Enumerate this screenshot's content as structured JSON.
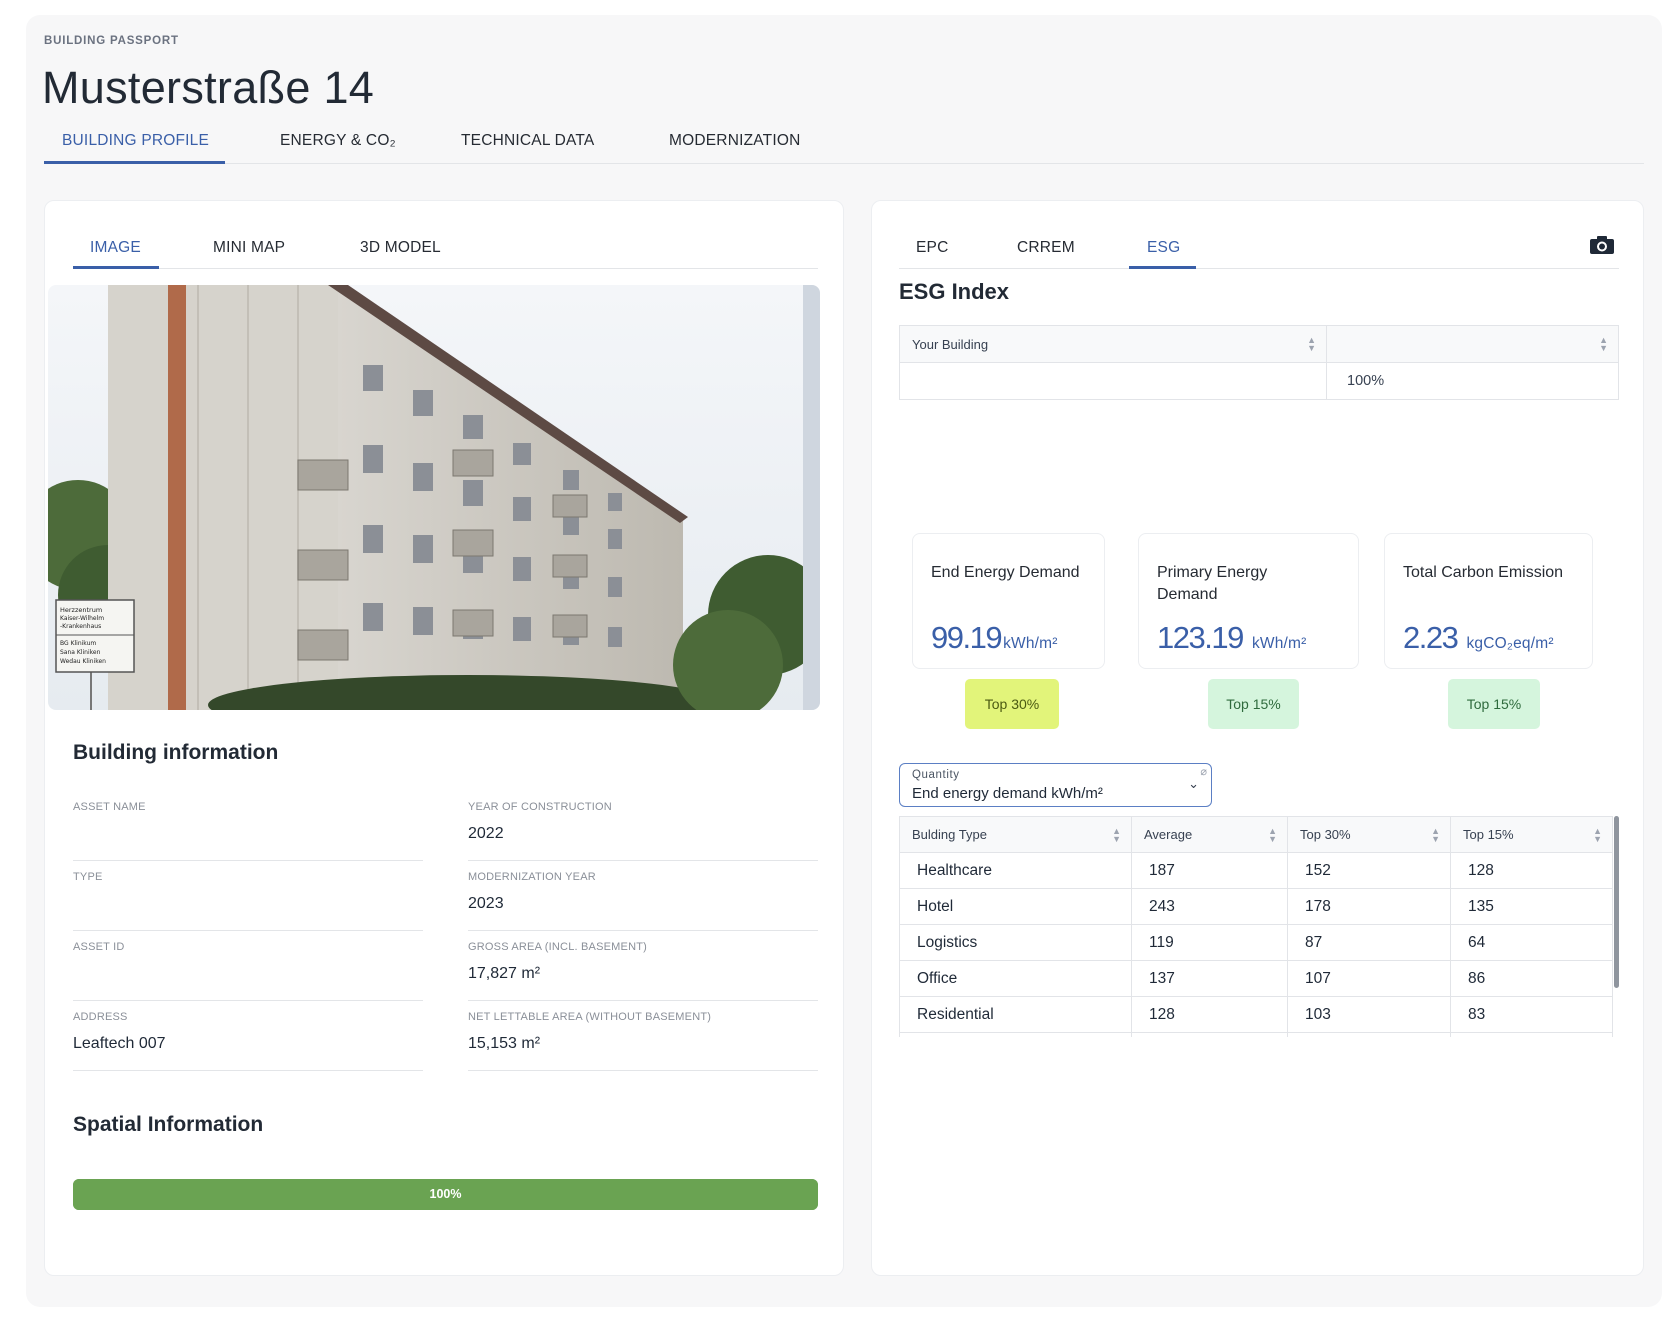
{
  "header": {
    "eyebrow": "BUILDING PASSPORT",
    "title": "Musterstraße 14"
  },
  "main_tabs": [
    {
      "label": "BUILDING PROFILE",
      "active": true
    },
    {
      "label": "ENERGY & CO₂",
      "active": false
    },
    {
      "label": "TECHNICAL DATA",
      "active": false
    },
    {
      "label": "MODERNIZATION",
      "active": false
    }
  ],
  "left": {
    "tabs": [
      {
        "label": "IMAGE",
        "active": true
      },
      {
        "label": "MINI MAP",
        "active": false
      },
      {
        "label": "3D MODEL",
        "active": false
      }
    ],
    "image_sign_lines": [
      "Herzzentrum",
      "Kaiser-Wilhelm",
      "-Krankenhaus",
      "BG Klinikum",
      "Sana Kliniken",
      "Wedau Kliniken"
    ],
    "building_info": {
      "title": "Building information",
      "fields": [
        {
          "label": "ASSET NAME",
          "value": ""
        },
        {
          "label": "YEAR OF CONSTRUCTION",
          "value": "2022"
        },
        {
          "label": "TYPE",
          "value": ""
        },
        {
          "label": "MODERNIZATION YEAR",
          "value": "2023"
        },
        {
          "label": "ASSET ID",
          "value": ""
        },
        {
          "label": "GROSS AREA (INCL. BASEMENT)",
          "value": "17,827 m²"
        },
        {
          "label": "ADDRESS",
          "value": "Leaftech 007"
        },
        {
          "label": "NET LETTABLE AREA (WITHOUT BASEMENT)",
          "value": "15,153 m²"
        }
      ]
    },
    "spatial": {
      "title": "Spatial Information",
      "progress_label": "100%",
      "progress_fraction": 1.0,
      "progress_color": "#6aa352"
    }
  },
  "right": {
    "tabs": [
      {
        "label": "EPC",
        "active": false
      },
      {
        "label": "CRREM",
        "active": false
      },
      {
        "label": "ESG",
        "active": true
      }
    ],
    "camera_icon": "camera-icon",
    "esg": {
      "title": "ESG Index",
      "headers": [
        "Your Building",
        ""
      ],
      "row": [
        "",
        "100%"
      ]
    },
    "metrics": [
      {
        "title": "End Energy Demand",
        "value": "99.19",
        "unit": "kWh/m²",
        "badge": "Top 30%",
        "badge_bg": "#e2f47a",
        "badge_fg": "#4b5a12"
      },
      {
        "title": "Primary Energy Demand",
        "value": "123.19",
        "unit": "kWh/m²",
        "badge": "Top 15%",
        "badge_bg": "#d5f5dd",
        "badge_fg": "#2f6b3d"
      },
      {
        "title": "Total Carbon Emission",
        "value": "2.23",
        "unit": "kgCO₂eq/m²",
        "badge": "Top 15%",
        "badge_bg": "#d5f5dd",
        "badge_fg": "#2f6b3d"
      }
    ],
    "quantity_select": {
      "label": "Quantity",
      "value": "End energy demand kWh/m²"
    },
    "benchmark": {
      "headers": [
        "Bulding Type",
        "Average",
        "Top 30%",
        "Top 15%"
      ],
      "rows": [
        [
          "Healthcare",
          "187",
          "152",
          "128"
        ],
        [
          "Hotel",
          "243",
          "178",
          "135"
        ],
        [
          "Logistics",
          "119",
          "87",
          "64"
        ],
        [
          "Office",
          "137",
          "107",
          "86"
        ],
        [
          "Residential",
          "128",
          "103",
          "83"
        ]
      ]
    }
  },
  "colors": {
    "accent": "#3a5fa8",
    "progress": "#6aa352"
  }
}
